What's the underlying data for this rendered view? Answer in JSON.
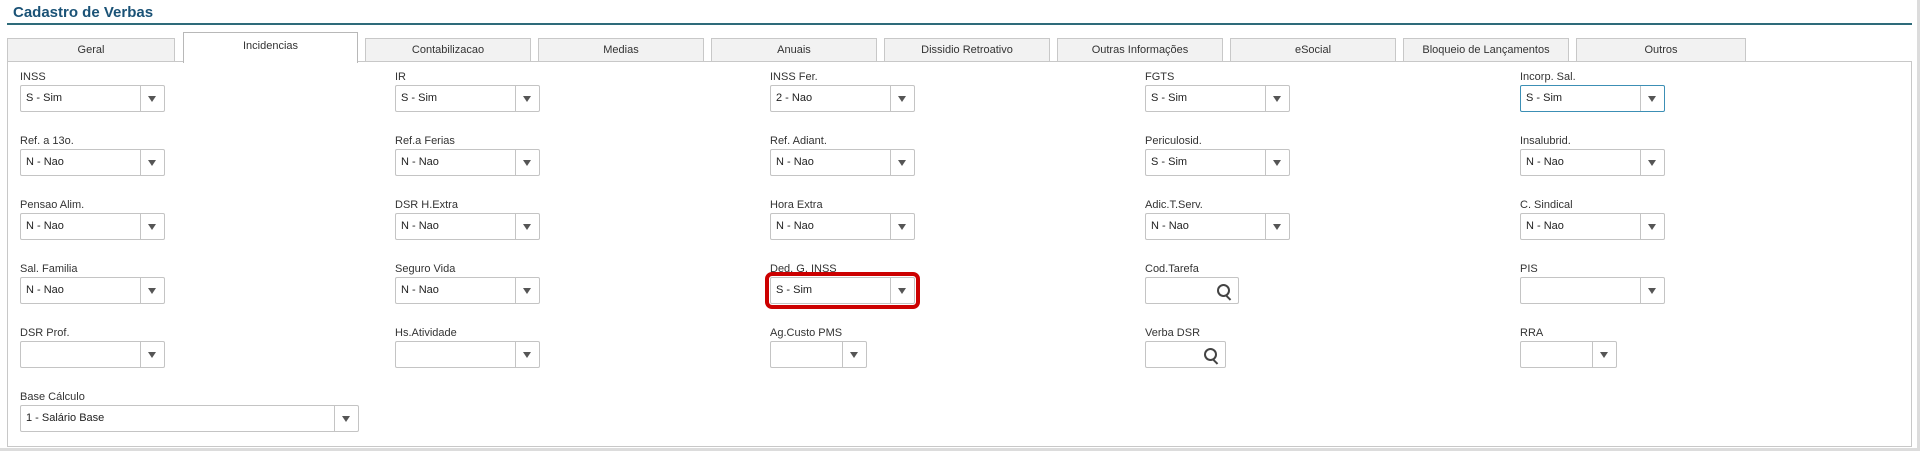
{
  "title": "Cadastro de Verbas",
  "tabs": [
    {
      "label": "Geral",
      "active": false
    },
    {
      "label": "Incidencias",
      "active": true
    },
    {
      "label": "Contabilizacao",
      "active": false
    },
    {
      "label": "Medias",
      "active": false
    },
    {
      "label": "Anuais",
      "active": false
    },
    {
      "label": "Dissidio Retroativo",
      "active": false
    },
    {
      "label": "Outras Informações",
      "active": false
    },
    {
      "label": "eSocial",
      "active": false
    },
    {
      "label": "Bloqueio de Lançamentos",
      "active": false
    },
    {
      "label": "Outros",
      "active": false
    }
  ],
  "fields": {
    "inss": {
      "label": "INSS",
      "value": "S - Sim"
    },
    "ir": {
      "label": "IR",
      "value": "S - Sim"
    },
    "inss_fer": {
      "label": "INSS Fer.",
      "value": "2 - Nao"
    },
    "fgts": {
      "label": "FGTS",
      "value": "S - Sim"
    },
    "incorp_sal": {
      "label": "Incorp. Sal.",
      "value": "S - Sim"
    },
    "ref_13o": {
      "label": "Ref. a 13o.",
      "value": "N - Nao"
    },
    "ref_ferias": {
      "label": "Ref.a Ferias",
      "value": "N - Nao"
    },
    "ref_adiant": {
      "label": "Ref. Adiant.",
      "value": "N - Nao"
    },
    "periculosid": {
      "label": "Periculosid.",
      "value": "S - Sim"
    },
    "insalubrid": {
      "label": "Insalubrid.",
      "value": "N - Nao"
    },
    "pensao_alim": {
      "label": "Pensao Alim.",
      "value": "N - Nao"
    },
    "dsr_hextra": {
      "label": "DSR H.Extra",
      "value": "N - Nao"
    },
    "hora_extra": {
      "label": "Hora Extra",
      "value": "N - Nao"
    },
    "adic_tserv": {
      "label": "Adic.T.Serv.",
      "value": "N - Nao"
    },
    "c_sindical": {
      "label": "C. Sindical",
      "value": "N - Nao"
    },
    "sal_familia": {
      "label": "Sal. Familia",
      "value": "N - Nao"
    },
    "seguro_vida": {
      "label": "Seguro Vida",
      "value": "N - Nao"
    },
    "ded_g_inss": {
      "label": "Ded. G. INSS",
      "value": "S - Sim"
    },
    "cod_tarefa": {
      "label": "Cod.Tarefa",
      "value": ""
    },
    "pis": {
      "label": "PIS",
      "value": ""
    },
    "dsr_prof": {
      "label": "DSR Prof.",
      "value": ""
    },
    "hs_atividade": {
      "label": "Hs.Atividade",
      "value": ""
    },
    "ag_custo_pms": {
      "label": "Ag.Custo PMS",
      "value": ""
    },
    "verba_dsr": {
      "label": "Verba DSR",
      "value": ""
    },
    "rra": {
      "label": "RRA",
      "value": ""
    },
    "base_calculo": {
      "label": "Base Cálculo",
      "value": "1 - Salário Base"
    }
  },
  "colors": {
    "title": "#1a5276",
    "highlight": "#cc0000",
    "focus": "#3c8fb5"
  },
  "icons": {
    "dropdown": "chevron-down-icon",
    "lookup": "search-icon"
  }
}
